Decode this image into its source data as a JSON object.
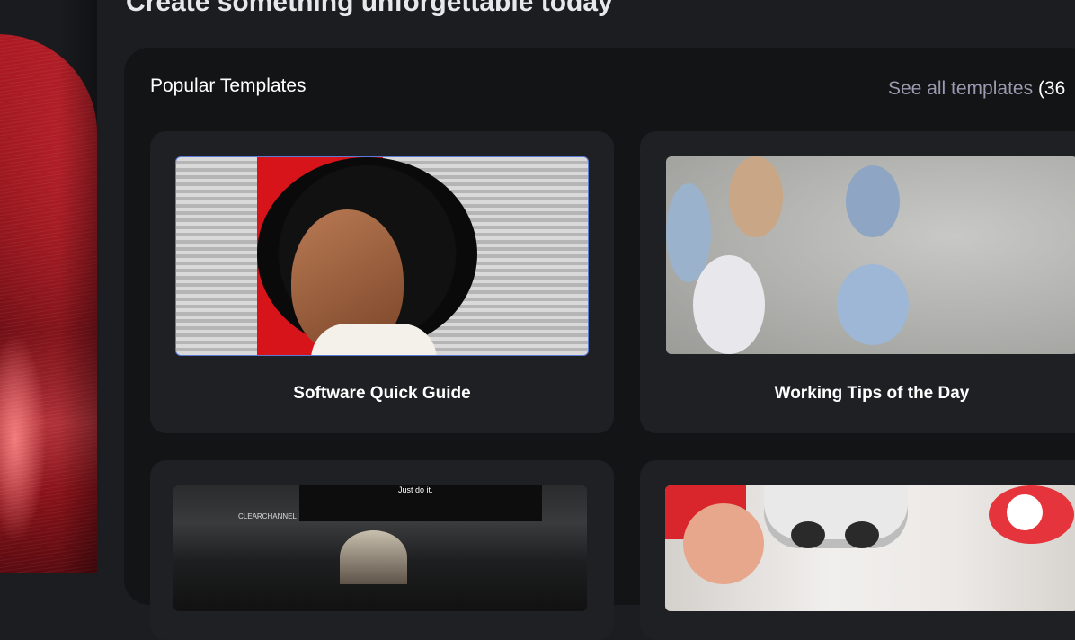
{
  "page": {
    "top_heading": "Create something unforgettable today"
  },
  "templates_panel": {
    "title": "Popular Templates",
    "see_all_label": "See all templates ",
    "see_all_count": "(36"
  },
  "cards": [
    {
      "label": "Software Quick Guide",
      "image": "woman-portrait-photo"
    },
    {
      "label": "Working Tips of the Day",
      "image": "team-meeting-photo"
    },
    {
      "label": "",
      "image": "billboard-street-photo",
      "billboard_text": "Just do it.",
      "billboard_brand": "CLEARCHANNEL"
    },
    {
      "label": "",
      "image": "vr-headset-photo"
    }
  ],
  "colors": {
    "background": "#1c1d20",
    "panel": "#131416",
    "card": "#1f2023",
    "link": "#9a9ab0",
    "accent_red": "#d8141b"
  }
}
